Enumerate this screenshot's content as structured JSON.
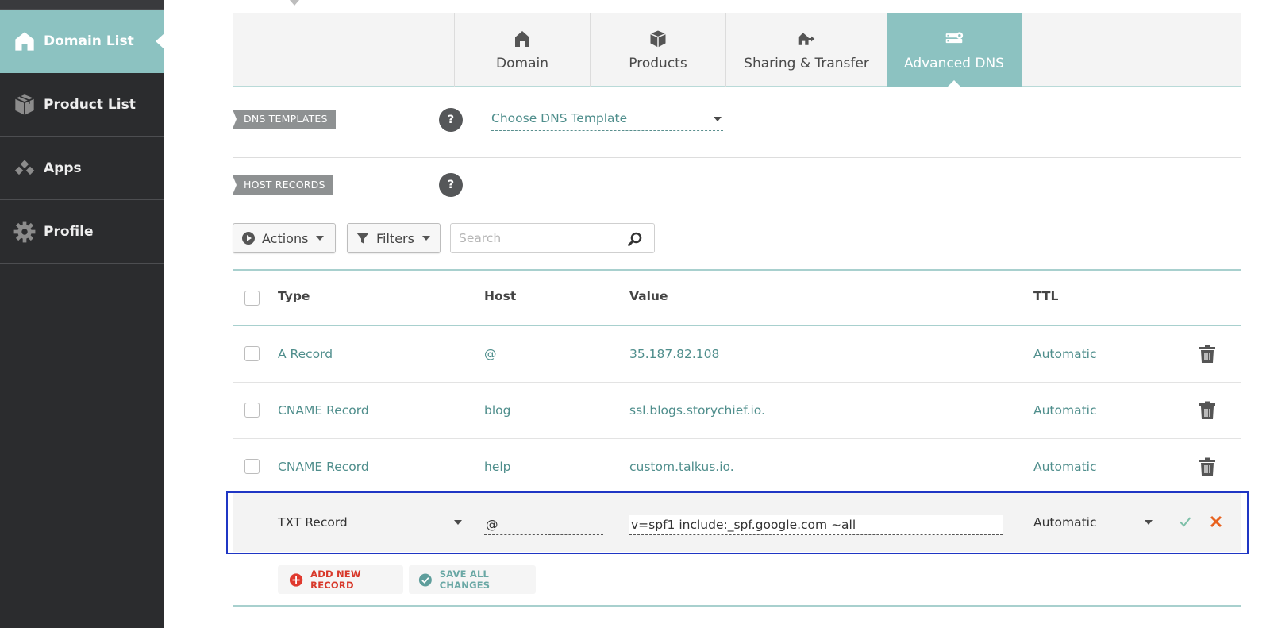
{
  "sidebar": {
    "items": [
      {
        "label": "Domain List",
        "icon": "home-icon",
        "active": true
      },
      {
        "label": "Product List",
        "icon": "box-icon",
        "active": false
      },
      {
        "label": "Apps",
        "icon": "apps-icon",
        "active": false
      },
      {
        "label": "Profile",
        "icon": "gear-icon",
        "active": false
      }
    ]
  },
  "tabs": [
    {
      "label": "Domain",
      "icon": "home-icon"
    },
    {
      "label": "Products",
      "icon": "box-icon"
    },
    {
      "label": "Sharing & Transfer",
      "icon": "transfer-icon"
    },
    {
      "label": "Advanced DNS",
      "icon": "dns-server-icon",
      "active": true
    }
  ],
  "dns_templates": {
    "label": "DNS TEMPLATES",
    "help": "?",
    "select_value": "Choose DNS Template"
  },
  "host_records": {
    "label": "HOST RECORDS",
    "help": "?"
  },
  "toolbar": {
    "actions_label": "Actions",
    "filters_label": "Filters",
    "search_placeholder": "Search"
  },
  "table": {
    "headers": {
      "type": "Type",
      "host": "Host",
      "value": "Value",
      "ttl": "TTL"
    },
    "rows": [
      {
        "type": "A Record",
        "host": "@",
        "value": "35.187.82.108",
        "ttl": "Automatic"
      },
      {
        "type": "CNAME Record",
        "host": "blog",
        "value": "ssl.blogs.storychief.io.",
        "ttl": "Automatic"
      },
      {
        "type": "CNAME Record",
        "host": "help",
        "value": "custom.talkus.io.",
        "ttl": "Automatic"
      }
    ],
    "edit_row": {
      "type": "TXT Record",
      "host": "@",
      "value": "v=spf1 include:_spf.google.com ~all",
      "ttl": "Automatic"
    }
  },
  "footer_actions": {
    "add_label": "ADD NEW RECORD",
    "save_label": "SAVE ALL CHANGES"
  },
  "colors": {
    "accent": "#8cc2c1",
    "link": "#4f8e8c",
    "sidebar_bg": "#2b2c2e",
    "add_red": "#e03a2f",
    "save_teal": "#5f9e9c",
    "edit_frame": "#1f36c4"
  }
}
